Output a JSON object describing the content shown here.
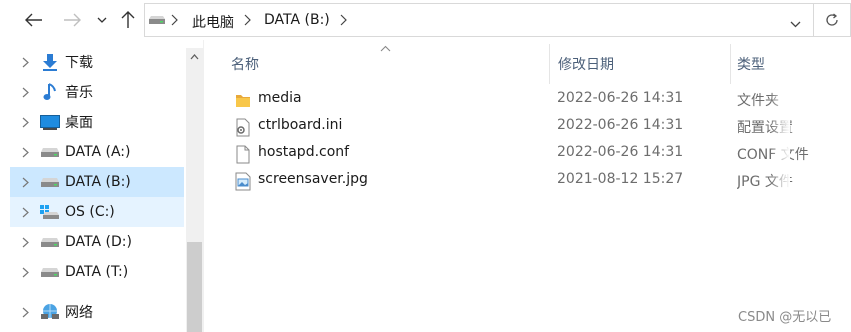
{
  "nav": {
    "back_icon": "arrow-left-icon",
    "forward_icon": "arrow-right-icon",
    "recent_icon": "chevron-down-icon",
    "up_icon": "arrow-up-icon"
  },
  "address": {
    "crumbs": [
      "此电脑",
      "DATA (B:)"
    ],
    "drive_icon": "drive-icon",
    "refresh_icon": "refresh-icon"
  },
  "sidebar": {
    "items": [
      {
        "label": "下载",
        "icon": "download-arrow-icon",
        "state": "normal"
      },
      {
        "label": "音乐",
        "icon": "music-note-icon",
        "state": "normal"
      },
      {
        "label": "桌面",
        "icon": "desktop-icon",
        "state": "normal"
      },
      {
        "label": "DATA (A:)",
        "icon": "drive-icon",
        "state": "normal"
      },
      {
        "label": "DATA (B:)",
        "icon": "drive-icon",
        "state": "selected"
      },
      {
        "label": "OS (C:)",
        "icon": "windows-drive-icon",
        "state": "hover"
      },
      {
        "label": "DATA (D:)",
        "icon": "drive-icon",
        "state": "normal"
      },
      {
        "label": "DATA (T:)",
        "icon": "drive-icon",
        "state": "normal"
      },
      {
        "label": "网络",
        "icon": "network-icon",
        "state": "normal"
      }
    ]
  },
  "columns": {
    "name": "名称",
    "modified": "修改日期",
    "type": "类型"
  },
  "files": [
    {
      "name": "media",
      "modified": "2022-06-26 14:31",
      "type": "文件夹",
      "icon": "folder-icon"
    },
    {
      "name": "ctrlboard.ini",
      "modified": "2022-06-26 14:31",
      "type": "配置设置",
      "icon": "settings-file-icon"
    },
    {
      "name": "hostapd.conf",
      "modified": "2022-06-26 14:31",
      "type": "CONF 文件",
      "icon": "file-icon"
    },
    {
      "name": "screensaver.jpg",
      "modified": "2021-08-12 15:27",
      "type": "JPG 文件",
      "icon": "image-file-icon"
    }
  ],
  "watermark": "CSDN @无以已",
  "colors": {
    "selected_bg": "#cce8ff",
    "hover_bg": "#e5f3ff",
    "header_text": "#4c607a",
    "folder_yellow": "#f8c74a"
  }
}
